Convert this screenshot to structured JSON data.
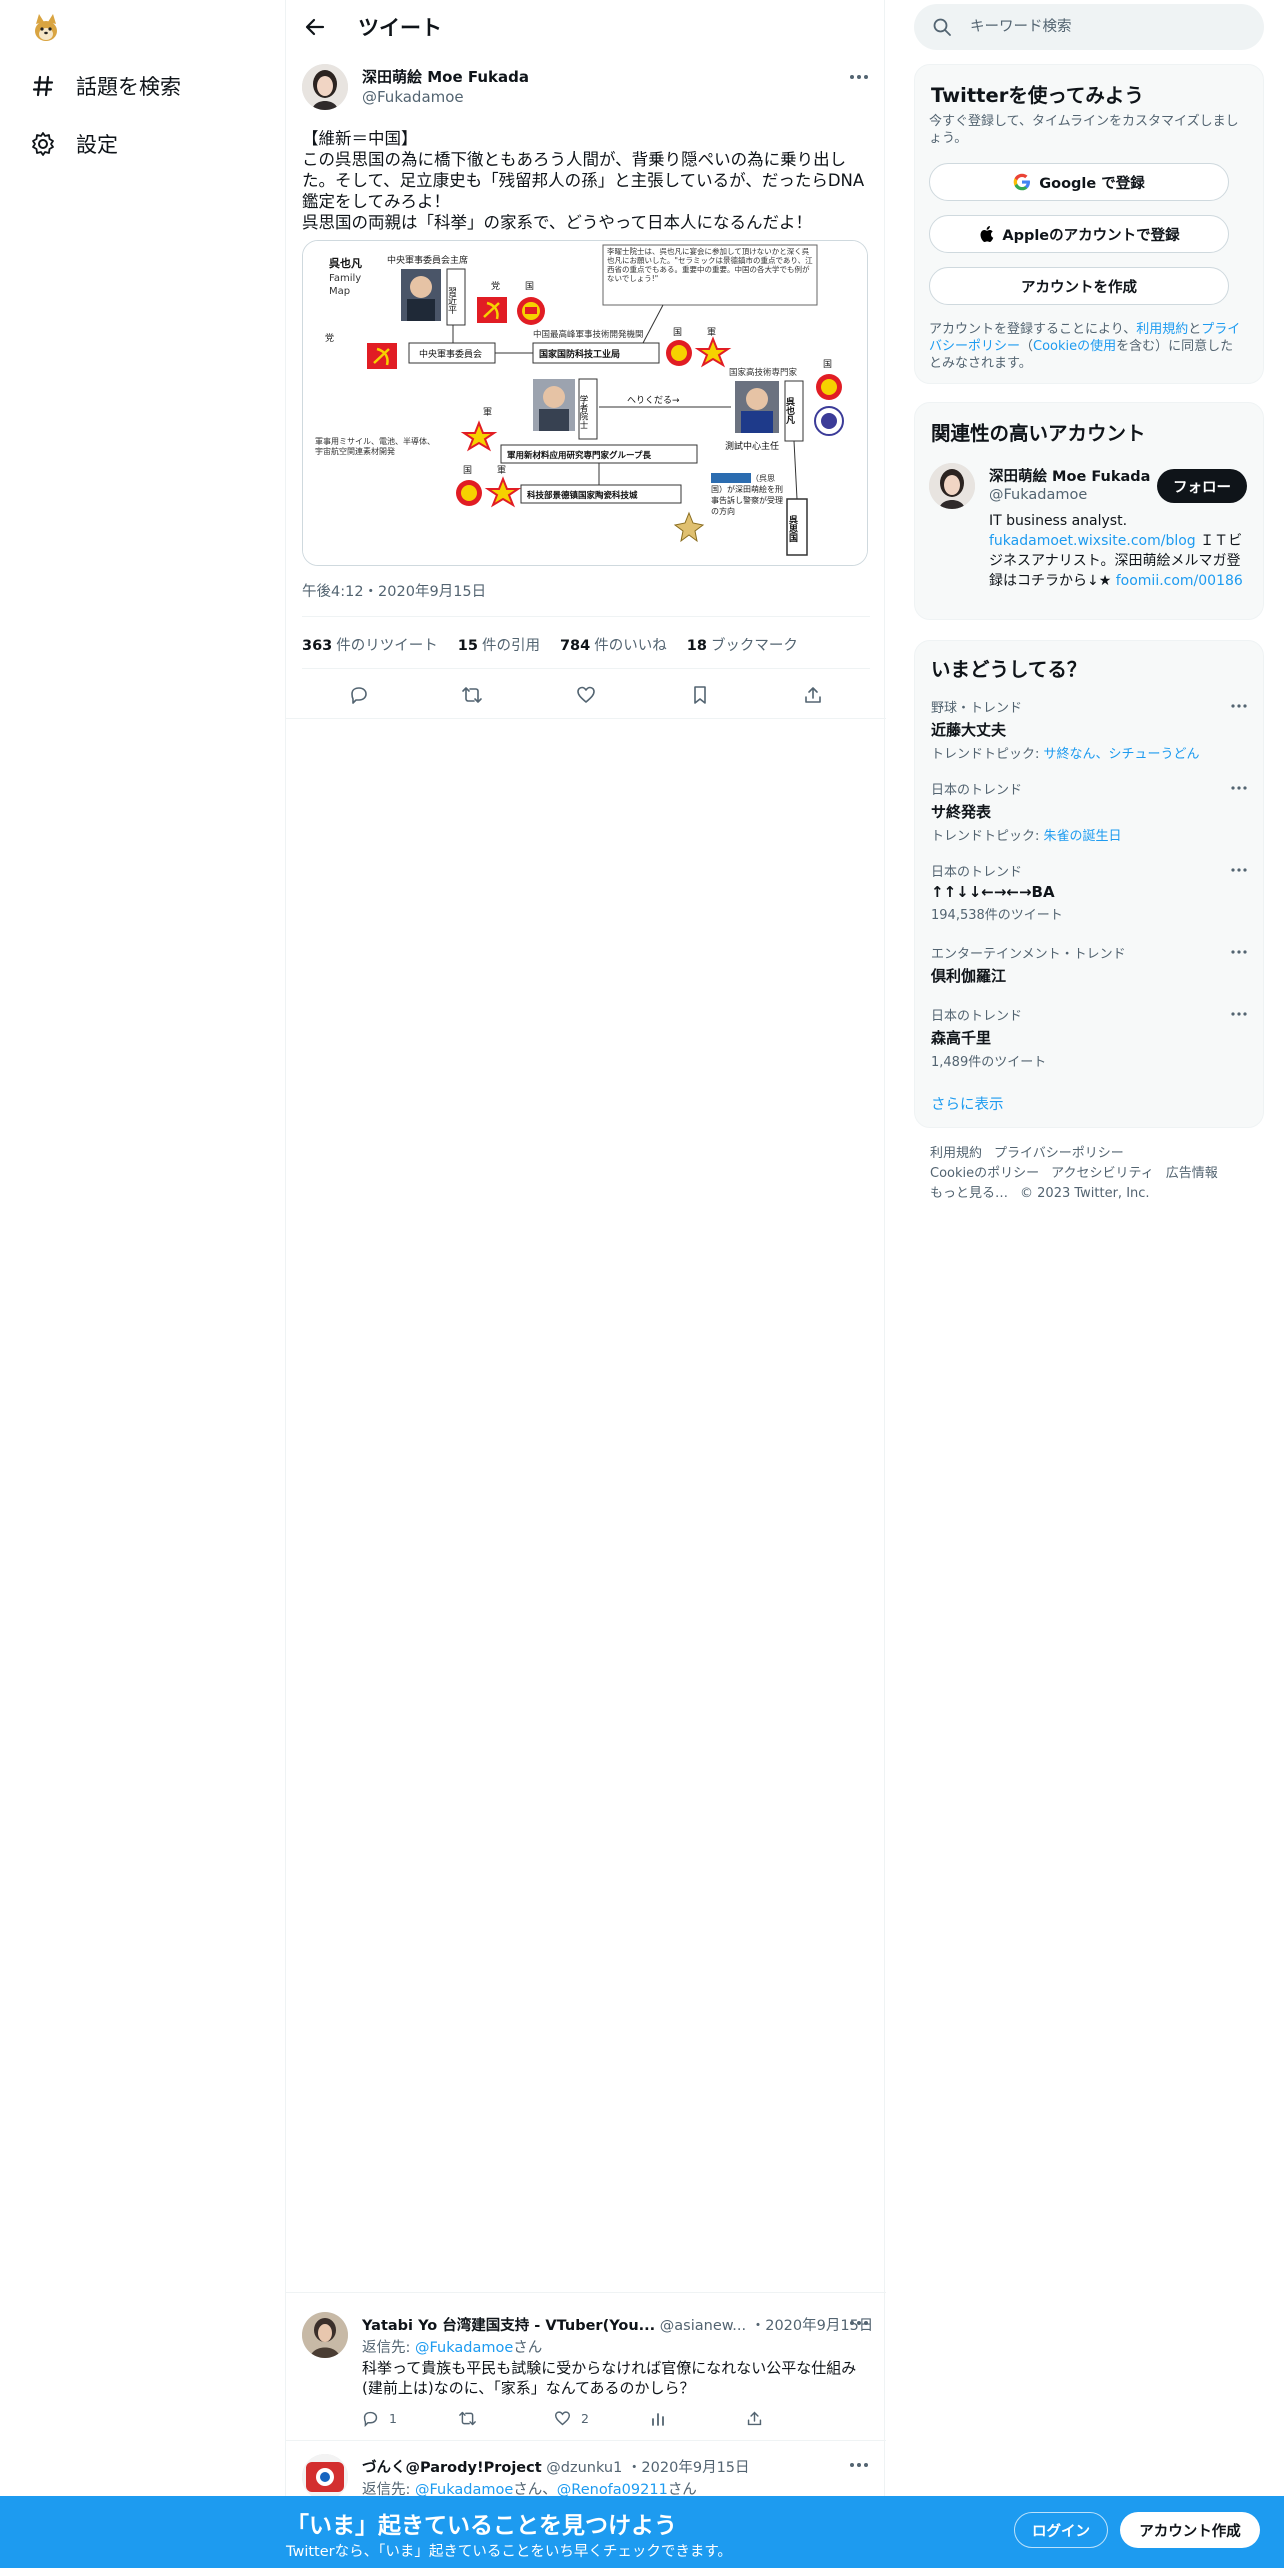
{
  "nav": {
    "explore_label": "話題を検索",
    "settings_label": "設定"
  },
  "header": {
    "title": "ツイート"
  },
  "tweet": {
    "author_name": "深田萌絵 Moe Fukada",
    "author_handle": "@Fukadamoe",
    "text": "【維新＝中国】\nこの呉思国の為に橋下徹ともあろう人間が、背乗り隠ぺいの為に乗り出した。そして、足立康史も「残留邦人の孫」と主張しているが、だったらDNA鑑定をしてみろよ！\n呉思国の両親は「科挙」の家系で、どうやって日本人になるんだよ！",
    "timestamp": "午後4:12・2020年9月15日",
    "stats": {
      "retweets_count": "363",
      "retweets_label": "件のリツイート",
      "quotes_count": "15",
      "quotes_label": "件の引用",
      "likes_count": "784",
      "likes_label": "件のいいね",
      "bookmarks_count": "18",
      "bookmarks_label": "ブックマーク"
    },
    "media": {
      "title_name": "呉也凡",
      "title_sub1": "Family",
      "title_sub2": "Map",
      "lbl_committee_chair": "中央軍事委員会主席",
      "lbl_xi_vertical": "習近平",
      "lbl_party1": "党",
      "lbl_state1": "国",
      "lbl_party2": "党",
      "lbl_cmc": "中央軍事委員会",
      "lbl_top_inst": "中国最高峰軍事技術開発機関",
      "lbl_defense_bureau": "国家国防科技工业局",
      "lbl_state2": "国",
      "lbl_army1": "軍",
      "lbl_quote": "李曜士院士は、呉也凡に宴会に参加して頂けないかと深く呉也凡にお願いした。\"セラミックは景德鎮市の重点であり、江西省の重点でもある。重要中の重要。中国の各大学でも例がないでしょう!\"",
      "lbl_national_expert": "国家高技術専門家",
      "lbl_state3": "国",
      "lbl_wu_vertical": "呉也凡",
      "lbl_academician": "学者院士",
      "lbl_descend": "へりくだる→",
      "lbl_test_center": "測試中心主任",
      "lbl_army2": "軍",
      "lbl_weapons": "軍事用ミサイル、電池、半導体、宇宙航空関連素材開発",
      "lbl_materials_group": "軍用新材料应用研究専門家グループ長",
      "lbl_state4": "国",
      "lbl_army3": "軍",
      "lbl_jdz_univ": "科技部景德镇国家陶瓷科技城",
      "lbl_note": "（呉思国）が深田萌絵を刑事告訴し警察が受理の方向",
      "lbl_wusiguo": "呉思国"
    }
  },
  "replies": [
    {
      "name": "Yatabi Yo 台湾建国支持 - VTuber(You...",
      "handle": "@asianew...",
      "date": "・2020年9月15日",
      "to_prefix": "返信先: ",
      "to_link": "@Fukadamoe",
      "to_suffix": "さん",
      "text": "科挙って貴族も平民も試験に受からなければ官僚になれない公平な仕組み(建前上は)なのに、「家系」なんてあるのかしら？",
      "replies_count": "1",
      "likes_count": "2"
    },
    {
      "name": "づんく@Parody!Project",
      "handle": "@dzunku1",
      "date": "・2020年9月15日",
      "to_prefix": "返信先: ",
      "to_link": "@Fukadamoe",
      "to_mid": "さん、",
      "to_link2": "@Renofa09211",
      "to_suffix": "さん"
    }
  ],
  "sidebar": {
    "search_placeholder": "キーワード検索",
    "signup_card": {
      "title": "Twitterを使ってみよう",
      "subtitle": "今すぐ登録して、タイムラインをカスタマイズしましょう。",
      "google_label": "Google で登録",
      "apple_label": "Appleのアカウントで登録",
      "create_label": "アカウントを作成",
      "legal_prefix": "アカウントを登録することにより、",
      "legal_terms": "利用規約",
      "legal_and": "と",
      "legal_privacy": "プライバシーポリシー",
      "legal_open": "（",
      "legal_cookie": "Cookieの使用",
      "legal_suffix": "を含む）に同意したとみなされます。"
    },
    "related": {
      "title": "関連性の高いアカウント",
      "name": "深田萌絵 Moe Fukada",
      "handle": "@Fukadamoe",
      "follow_label": "フォロー",
      "bio_line1": "IT business analyst.",
      "bio_link1": "fukadamoet.wixsite.com/blog",
      "bio_mid": "ＩＴビジネスアナリスト。深田萌絵メルマガ登録はコチラから↓★",
      "bio_link2": "foomii.com/00186"
    },
    "trends": {
      "title": "いまどうしてる？",
      "items": [
        {
          "category": "野球・トレンド",
          "name": "近藤大丈夫",
          "sub_prefix": "トレンドトピック: ",
          "sub_links": "サ終なん、シチューうどん"
        },
        {
          "category": "日本のトレンド",
          "name": "サ終発表",
          "sub_prefix": "トレンドトピック: ",
          "sub_links": "朱雀の誕生日"
        },
        {
          "category": "日本のトレンド",
          "name": "↑↑↓↓←→←→BA",
          "sub_plain": "194,538件のツイート"
        },
        {
          "category": "エンターテインメント・トレンド",
          "name": "倶利伽羅江"
        },
        {
          "category": "日本のトレンド",
          "name": "森高千里",
          "sub_plain": "1,489件のツイート"
        }
      ],
      "show_more": "さらに表示"
    },
    "footer": {
      "terms": "利用規約",
      "privacy": "プライバシーポリシー",
      "cookie": "Cookieのポリシー",
      "accessibility": "アクセシビリティ",
      "ads": "広告情報",
      "more": "もっと見る…",
      "copyright": "© 2023 Twitter, Inc."
    }
  },
  "bottom_bar": {
    "title": "「いま」起きていることを見つけよう",
    "subtitle": "Twitterなら、「いま」起きていることをいち早くチェックできます。",
    "login_label": "ログイン",
    "signup_label": "アカウント作成"
  },
  "colors": {
    "accent": "#1d9bf0",
    "text": "#0f1419",
    "muted": "#536471",
    "border": "#eff3f4"
  }
}
